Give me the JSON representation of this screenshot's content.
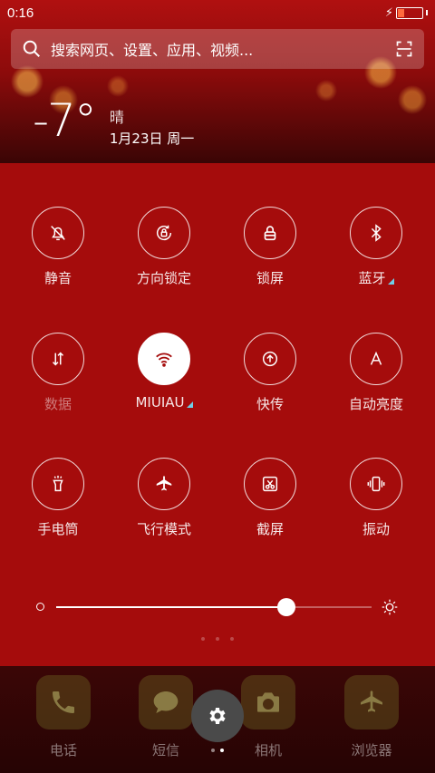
{
  "status_bar": {
    "time": "0:16",
    "battery_level": 0.25
  },
  "search": {
    "placeholder": "搜索网页、设置、应用、视频..."
  },
  "weather": {
    "temperature": "-7°",
    "condition": "晴",
    "date": "1月23日 周一"
  },
  "toggles": [
    {
      "label": "静音",
      "icon": "bell-off-icon",
      "active": false
    },
    {
      "label": "方向锁定",
      "icon": "rotation-lock-icon",
      "active": false
    },
    {
      "label": "锁屏",
      "icon": "lock-icon",
      "active": false
    },
    {
      "label": "蓝牙",
      "icon": "bluetooth-icon",
      "active": false
    },
    {
      "label": "数据",
      "icon": "mobile-data-icon",
      "active": false
    },
    {
      "label": "MIUIAU",
      "icon": "wifi-icon",
      "active": true
    },
    {
      "label": "快传",
      "icon": "transfer-icon",
      "active": false
    },
    {
      "label": "自动亮度",
      "icon": "auto-brightness-icon",
      "active": false
    },
    {
      "label": "手电筒",
      "icon": "flashlight-icon",
      "active": false
    },
    {
      "label": "飞行模式",
      "icon": "airplane-icon",
      "active": false
    },
    {
      "label": "截屏",
      "icon": "screenshot-icon",
      "active": false
    },
    {
      "label": "振动",
      "icon": "vibrate-icon",
      "active": false
    }
  ],
  "brightness": {
    "level": 0.73
  },
  "dock": {
    "apps": [
      {
        "label": "电话",
        "icon": "phone-icon"
      },
      {
        "label": "短信",
        "icon": "message-icon"
      },
      {
        "label": "相机",
        "icon": "camera-icon"
      },
      {
        "label": "浏览器",
        "icon": "browser-icon"
      }
    ],
    "settings_icon": "gear-icon"
  },
  "colors": {
    "panel": "#a50c0c",
    "accent_mark": "#6fd0e8",
    "battery": "#ff6a3d"
  }
}
